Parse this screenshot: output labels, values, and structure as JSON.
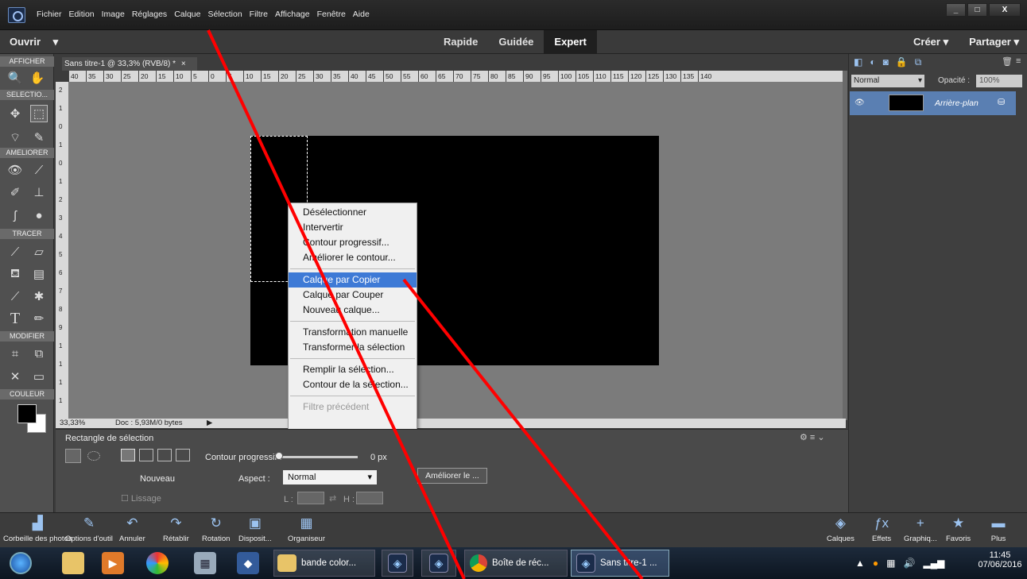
{
  "menubar": {
    "items": [
      "Fichier",
      "Edition",
      "Image",
      "Réglages",
      "Calque",
      "Sélection",
      "Filtre",
      "Affichage",
      "Fenêtre",
      "Aide"
    ]
  },
  "window_controls": {
    "minimize": "_",
    "maximize": "□",
    "close": "X"
  },
  "modebar": {
    "open_label": "Ouvrir",
    "open_arrow": "▾",
    "modes": [
      "Rapide",
      "Guidée",
      "Expert"
    ],
    "active_mode": "Expert",
    "create_label": "Créer ▾",
    "share_label": "Partager ▾"
  },
  "toolbox": {
    "sections": [
      "AFFICHER",
      "SELECTIO...",
      "AMELIORER",
      "TRACER",
      "MODIFIER",
      "COULEUR"
    ]
  },
  "document": {
    "tab_title": "Sans titre-1 @ 33,3% (RVB/8) *",
    "tab_close": "×",
    "zoom": "33,33%",
    "doc_info": "Doc : 5,93M/0 bytes"
  },
  "ruler": {
    "h_ticks": [
      "40",
      "35",
      "30",
      "25",
      "20",
      "15",
      "10",
      "5",
      "0",
      "5",
      "10",
      "15",
      "20",
      "25",
      "30",
      "35",
      "40",
      "45",
      "50",
      "55",
      "60",
      "65",
      "70",
      "75",
      "80",
      "85",
      "90",
      "95",
      "100",
      "105",
      "110",
      "115",
      "120",
      "125",
      "130",
      "135",
      "140"
    ],
    "v_ticks": [
      "2",
      "1",
      "0",
      "1",
      "0",
      "1",
      "2",
      "3",
      "4",
      "5",
      "6",
      "7",
      "8",
      "9",
      "1",
      "1",
      "1",
      "1"
    ]
  },
  "context_menu": {
    "groups": [
      [
        "Désélectionner",
        "Intervertir",
        "Contour progressif...",
        "Améliorer le contour..."
      ],
      [
        "Calque par Copier",
        "Calque par Couper",
        "Nouveau calque..."
      ],
      [
        "Transformation manuelle",
        "Transformer la sélection"
      ],
      [
        "Remplir la sélection...",
        "Contour de la sélection..."
      ],
      [
        "Filtre précédent"
      ]
    ],
    "highlighted": "Calque par Copier",
    "disabled": "Filtre précédent"
  },
  "options": {
    "tool_name": "Rectangle de sélection",
    "feather_label": "Contour progressif :",
    "feather_value": "0 px",
    "aspect_label": "Aspect :",
    "aspect_value": "Normal",
    "new_label": "Nouveau",
    "smooth_label": "Lissage",
    "width_label": "L :",
    "height_label": "H :",
    "refine_button": "Améliorer le ..."
  },
  "layers": {
    "blend_mode": "Normal",
    "opacity_label": "Opacité :",
    "opacity_value": "100%",
    "layer_name": "Arrière-plan"
  },
  "bottom_left": [
    {
      "label": "Corbeille des photos",
      "icon": "photo-bin-icon"
    },
    {
      "label": "Options d'outil",
      "icon": "tool-options-icon"
    },
    {
      "label": "Annuler",
      "icon": "undo-icon"
    },
    {
      "label": "Rétablir",
      "icon": "redo-icon"
    },
    {
      "label": "Rotation",
      "icon": "rotate-icon"
    },
    {
      "label": "Disposit...",
      "icon": "layout-icon"
    },
    {
      "label": "Organiseur",
      "icon": "organizer-icon"
    }
  ],
  "bottom_right": [
    {
      "label": "Calques",
      "icon": "layers-icon"
    },
    {
      "label": "Effets",
      "icon": "fx-icon"
    },
    {
      "label": "Graphiq...",
      "icon": "graphics-icon"
    },
    {
      "label": "Favoris",
      "icon": "star-icon"
    },
    {
      "label": "Plus",
      "icon": "more-icon"
    }
  ],
  "taskbar": {
    "items": [
      "bande color...",
      "Boîte de réc...",
      "Sans titre-1 ..."
    ],
    "time": "11:45",
    "date": "07/06/2016"
  },
  "colors": {
    "accent": "#3e7ad6",
    "layer_highlight": "#5a7fb2",
    "annotation_line": "#ff0000"
  }
}
